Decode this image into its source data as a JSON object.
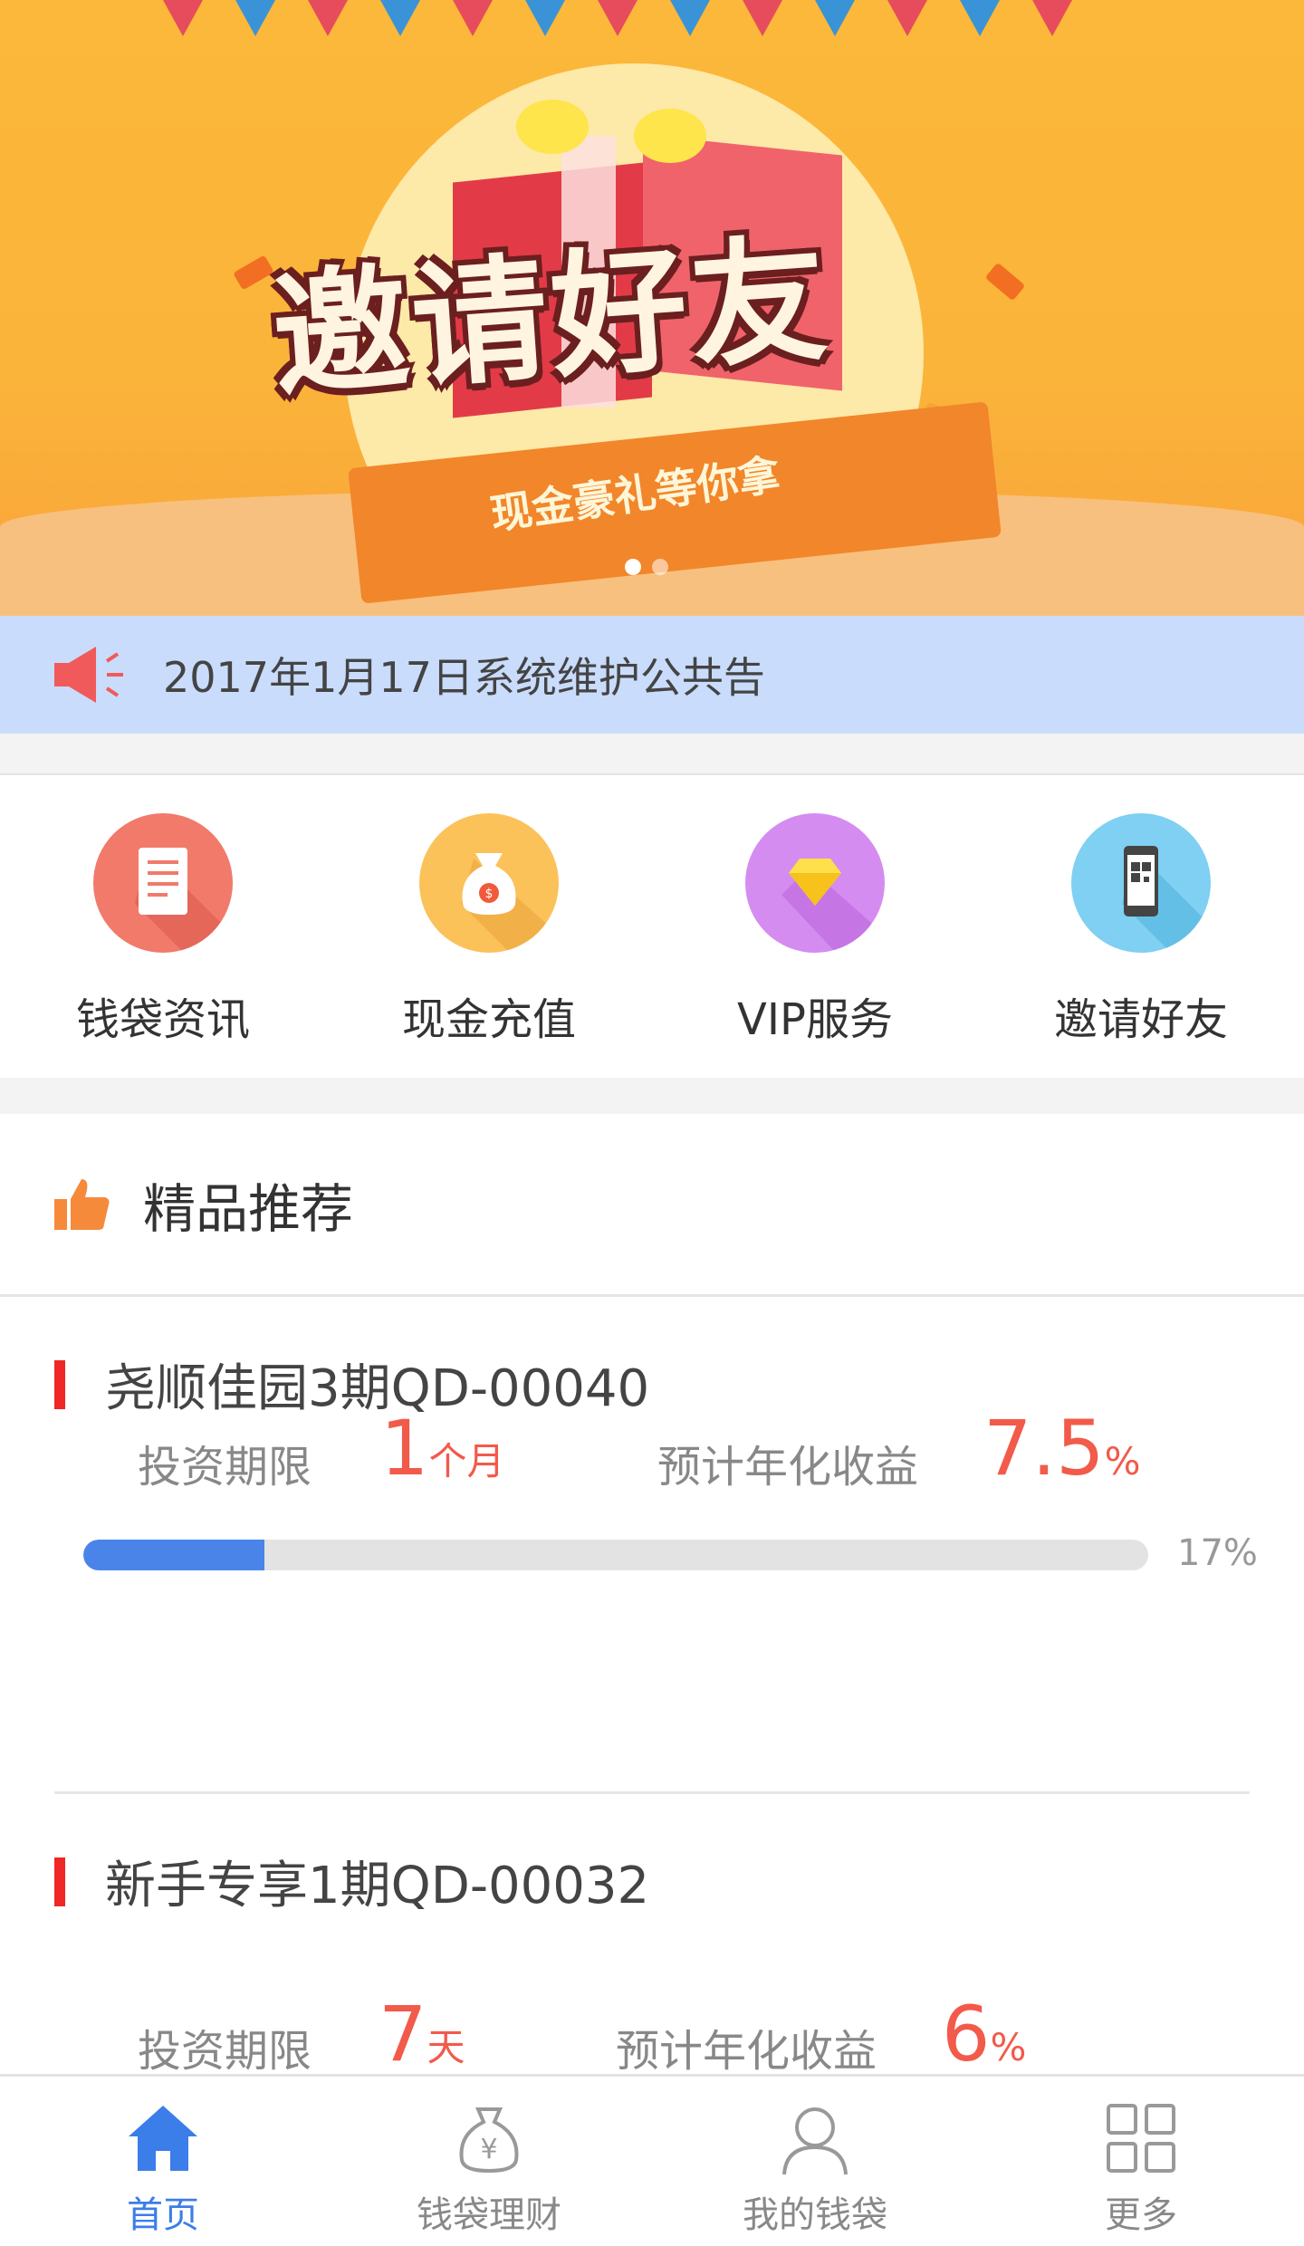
{
  "banner": {
    "title": "邀请好友",
    "subtitle": "现金豪礼等你拿",
    "slide_count": 2,
    "active_slide": 1
  },
  "notice": {
    "text": "2017年1月17日系统维护公共告",
    "icon": "megaphone-icon"
  },
  "quick_actions": [
    {
      "label": "钱袋资讯",
      "icon": "document-icon",
      "color": "#f17a6b"
    },
    {
      "label": "现金充值",
      "icon": "money-bag-icon",
      "color": "#fbc25a"
    },
    {
      "label": "VIP服务",
      "icon": "diamond-icon",
      "color": "#d58cf1"
    },
    {
      "label": "邀请好友",
      "icon": "phone-qr-icon",
      "color": "#7fd0f2"
    }
  ],
  "featured": {
    "title": "精品推荐",
    "icon": "thumbs-up-icon",
    "products": [
      {
        "name": "尧顺佳园3期QD-00040",
        "term_label": "投资期限",
        "term_value": "1",
        "term_unit": "个月",
        "yield_label": "预计年化收益",
        "yield_value": "7.5",
        "yield_unit": "%",
        "progress": 0.17,
        "progress_text": "17%"
      },
      {
        "name": "新手专享1期QD-00032",
        "term_label": "投资期限",
        "term_value": "7",
        "term_unit": "天",
        "yield_label": "预计年化收益",
        "yield_value": "6",
        "yield_unit": "%"
      }
    ]
  },
  "tabbar": {
    "items": [
      {
        "label": "首页",
        "icon": "home-icon",
        "active": true
      },
      {
        "label": "钱袋理财",
        "icon": "yen-bag-icon",
        "active": false
      },
      {
        "label": "我的钱袋",
        "icon": "user-icon",
        "active": false
      },
      {
        "label": "更多",
        "icon": "grid-icon",
        "active": false
      }
    ]
  },
  "colors": {
    "accent_blue": "#3b7de9",
    "accent_red": "#f25a4a",
    "notice_bg": "#c9dcfb",
    "banner_bg": "#fbb83a"
  }
}
